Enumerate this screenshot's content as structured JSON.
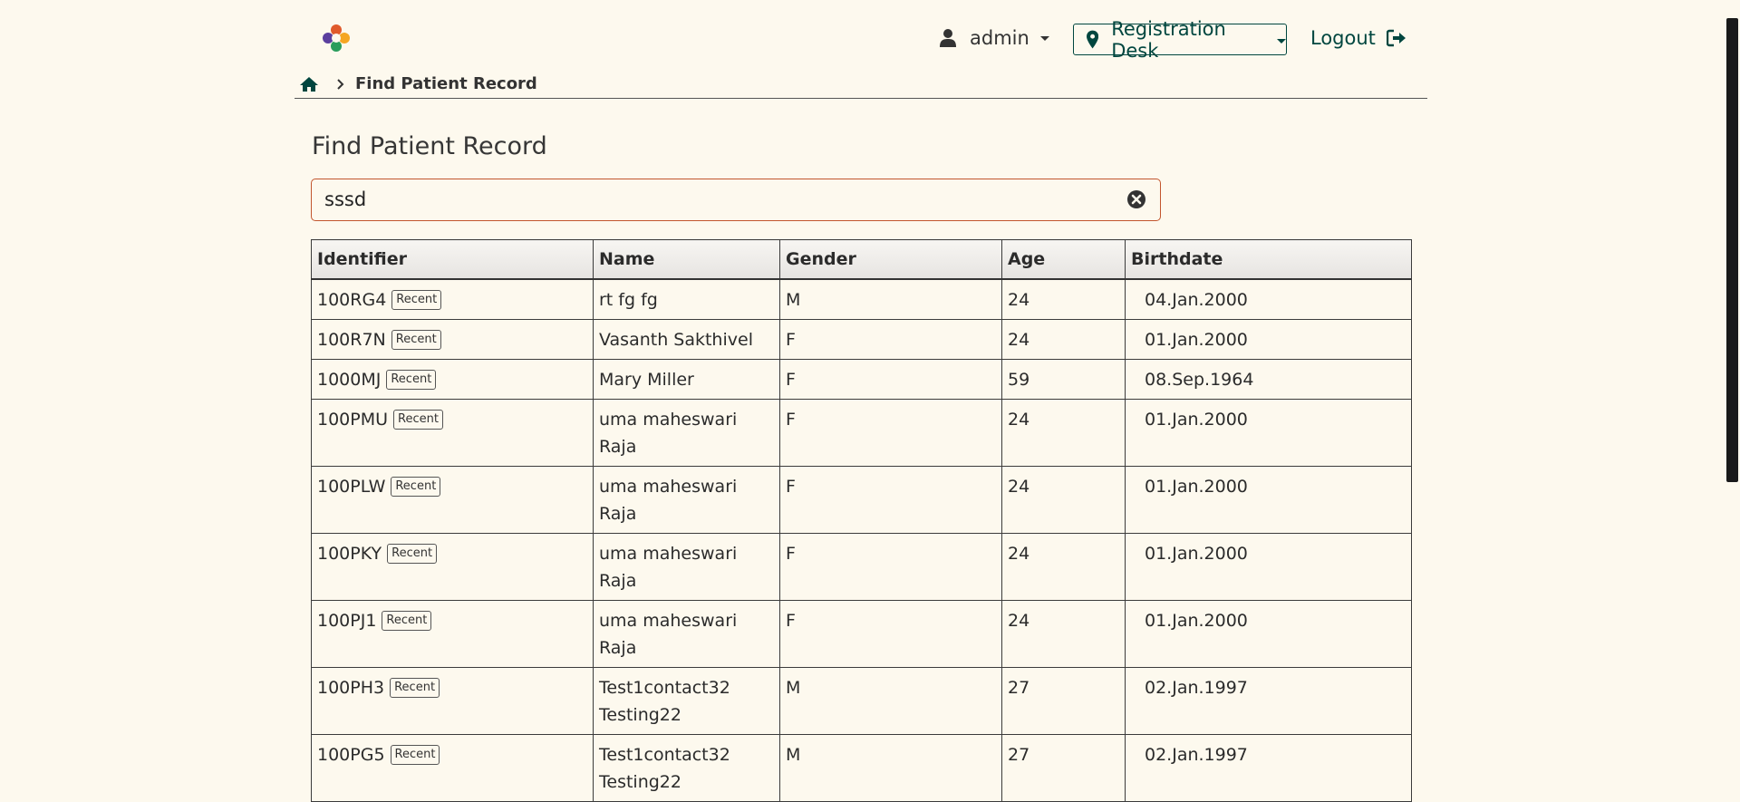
{
  "header": {
    "logo_text": "OpenMRS",
    "user": {
      "name": "admin",
      "icon": "user-icon"
    },
    "location": {
      "label": "Registration Desk",
      "icon": "map-marker-icon"
    },
    "logout": {
      "label": "Logout",
      "icon": "sign-out-icon"
    }
  },
  "breadcrumb": {
    "home_icon": "home-icon",
    "current": "Find Patient Record"
  },
  "page": {
    "title": "Find Patient Record"
  },
  "search": {
    "value": "sssd",
    "placeholder": ""
  },
  "table": {
    "headers": [
      "Identifier",
      "Name",
      "Gender",
      "Age",
      "Birthdate"
    ],
    "badge": "Recent",
    "rows": [
      {
        "id": "100RG4",
        "name": "rt fg fg",
        "gender": "M",
        "age": "24",
        "birthdate": "04.Jan.2000"
      },
      {
        "id": "100R7N",
        "name": "Vasanth Sakthivel",
        "gender": "F",
        "age": "24",
        "birthdate": "01.Jan.2000"
      },
      {
        "id": "1000MJ",
        "name": "Mary Miller",
        "gender": "F",
        "age": "59",
        "birthdate": "08.Sep.1964"
      },
      {
        "id": "100PMU",
        "name": "uma maheswari Raja",
        "gender": "F",
        "age": "24",
        "birthdate": "01.Jan.2000"
      },
      {
        "id": "100PLW",
        "name": "uma maheswari Raja",
        "gender": "F",
        "age": "24",
        "birthdate": "01.Jan.2000"
      },
      {
        "id": "100PKY",
        "name": "uma maheswari Raja",
        "gender": "F",
        "age": "24",
        "birthdate": "01.Jan.2000"
      },
      {
        "id": "100PJ1",
        "name": "uma maheswari Raja",
        "gender": "F",
        "age": "24",
        "birthdate": "01.Jan.2000"
      },
      {
        "id": "100PH3",
        "name": "Test1contact32 Testing22",
        "gender": "M",
        "age": "27",
        "birthdate": "02.Jan.1997"
      },
      {
        "id": "100PG5",
        "name": "Test1contact32 Testing22",
        "gender": "M",
        "age": "27",
        "birthdate": "02.Jan.1997"
      }
    ]
  },
  "colors": {
    "background": "#fdf9ee",
    "accent": "#00463f",
    "search_border": "#c2562e"
  }
}
